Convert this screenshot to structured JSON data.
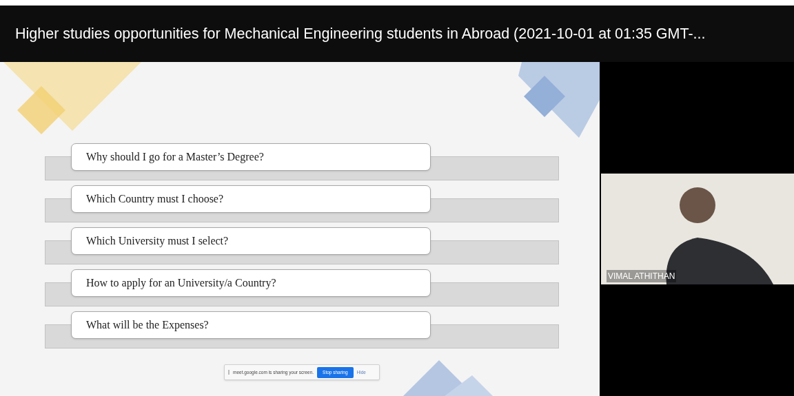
{
  "video_title": "Higher studies opportunities for Mechanical Engineering students in Abroad (2021-10-01 at 01:35 GMT-...",
  "slide": {
    "questions": [
      "Why should I go for a Master’s Degree?",
      "Which Country must I choose?",
      "Which University must I select?",
      "How to apply for an University/a Country?",
      "What will be the Expenses?"
    ]
  },
  "share_notice": {
    "message": "meet.google.com is sharing your screen.",
    "stop_button": "Stop sharing",
    "hide_link": "Hide"
  },
  "participant": {
    "name": "VIMAL ATHITHAN"
  }
}
